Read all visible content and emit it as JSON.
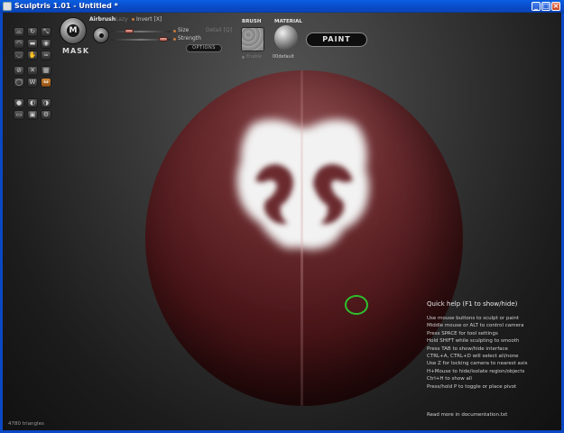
{
  "window": {
    "title": "Sculptris 1.01 - Untitled *",
    "controls": [
      "_",
      "□",
      "×"
    ]
  },
  "toolbar": {
    "tool_icons": [
      "crease-icon",
      "rotate-icon",
      "scale-icon",
      "draw-icon",
      "flatten-icon",
      "inflate-icon",
      "pinch-icon",
      "grab-icon",
      "smooth-icon",
      "reduce-brush-icon",
      "symmetry-icon",
      "wireframe-icon",
      "sphere-icon",
      "new-object-icon",
      "paint-toggle-icon",
      "camera-icon",
      "import-icon",
      "export-icon"
    ],
    "mask": {
      "label": "MASK",
      "glyph": "M"
    },
    "airbrush_label": "Airbrush",
    "lazy_label": "Lazy",
    "invert_label": "Invert [X]",
    "size_label": "Size",
    "strength_label": "Strength",
    "detail_label": "Detail [Q]",
    "options_label": "OPTIONS",
    "brush_label": "BRUSH",
    "enable_label": "Enable",
    "material_label": "MATERIAL",
    "material_name": "00default",
    "paint_label": "PAINT"
  },
  "help": {
    "title": "Quick help (F1 to show/hide)",
    "lines": [
      "Use mouse buttons to sculpt or paint",
      "Middle mouse or ALT to control camera",
      "Press SPACE for tool settings",
      "Hold SHIFT while sculpting to smooth",
      "Press TAB to show/hide interface",
      "CTRL+A, CTRL+D will select all/none",
      "Use Z for locking camera to nearest axis",
      "H+Mouse to hide/isolate region/objects",
      "Ctrl+H to show all",
      "Press/hold P to toggle or place pivot"
    ],
    "footer": "Read more in documentation.txt"
  },
  "status": {
    "triangles": "4780 triangles"
  },
  "colors": {
    "accent": "#c57a3c",
    "cursor": "#2ec02e",
    "title_bar": "#0a48c4"
  }
}
